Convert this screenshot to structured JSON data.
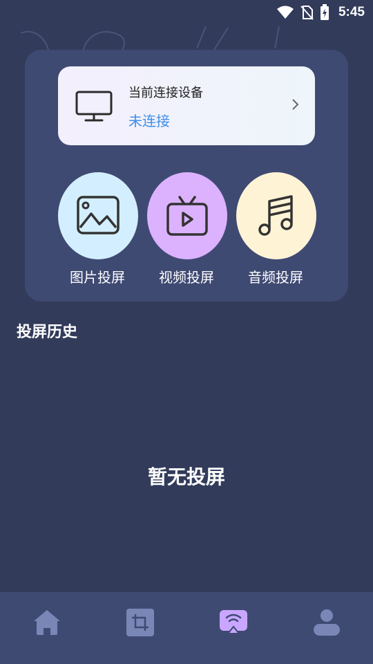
{
  "status_bar": {
    "time": "5:45",
    "icons": [
      "wifi-icon",
      "no-sim-icon",
      "battery-charging-icon"
    ]
  },
  "device": {
    "title": "当前连接设备",
    "status": "未连接",
    "icon": "monitor-icon"
  },
  "features": [
    {
      "label": "图片投屏",
      "icon": "image-icon",
      "color": "#d3efff"
    },
    {
      "label": "视频投屏",
      "icon": "tv-play-icon",
      "color": "#dcb2ff"
    },
    {
      "label": "音频投屏",
      "icon": "music-note-icon",
      "color": "#fff3d6"
    }
  ],
  "history": {
    "title": "投屏历史",
    "empty_text": "暂无投屏"
  },
  "tabbar": {
    "tabs": [
      {
        "icon": "home-icon",
        "active": false
      },
      {
        "icon": "crop-icon",
        "active": false
      },
      {
        "icon": "screencast-icon",
        "active": true
      },
      {
        "icon": "user-icon",
        "active": false
      }
    ],
    "active_color": "#c9a6ff",
    "inactive_color": "#7a86b5"
  }
}
